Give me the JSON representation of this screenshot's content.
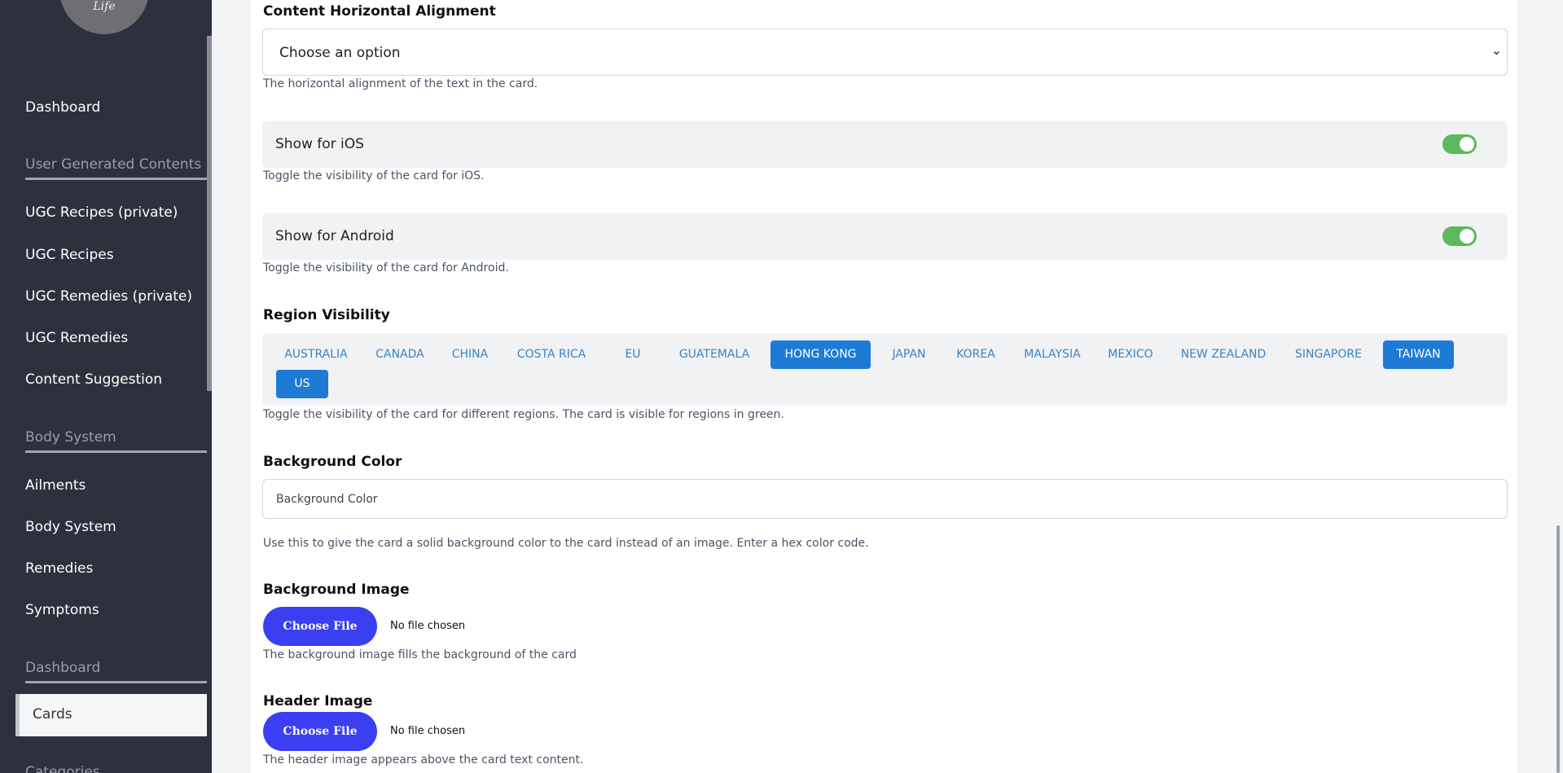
{
  "sidebar": {
    "logo_text": "Life",
    "items": [
      {
        "label": "Dashboard"
      },
      {
        "label": "User Generated Contents",
        "heading": true
      },
      {
        "label": "UGC Recipes (private)"
      },
      {
        "label": "UGC Recipes"
      },
      {
        "label": "UGC Remedies (private)"
      },
      {
        "label": "UGC Remedies"
      },
      {
        "label": "Content Suggestion"
      },
      {
        "label": "Body System",
        "heading": true
      },
      {
        "label": "Ailments"
      },
      {
        "label": "Body System"
      },
      {
        "label": "Remedies"
      },
      {
        "label": "Symptoms"
      },
      {
        "label": "Dashboard",
        "heading": true
      },
      {
        "label": "Cards",
        "active": true
      },
      {
        "label": "Categories",
        "heading": true
      }
    ]
  },
  "form": {
    "alignment": {
      "label": "Content Horizontal Alignment",
      "value": "Choose an option",
      "help": "The horizontal alignment of the text in the card."
    },
    "ios": {
      "label": "Show for iOS",
      "enabled": true,
      "help": "Toggle the visibility of the card for iOS."
    },
    "android": {
      "label": "Show for Android",
      "enabled": true,
      "help": "Toggle the visibility of the card for Android."
    },
    "regions": {
      "label": "Region Visibility",
      "help": "Toggle the visibility of the card for different regions. The card is visible for regions in green.",
      "items": [
        {
          "name": "AUSTRALIA",
          "selected": false
        },
        {
          "name": "CANADA",
          "selected": false
        },
        {
          "name": "CHINA",
          "selected": false
        },
        {
          "name": "COSTA RICA",
          "selected": false
        },
        {
          "name": "EU",
          "selected": false
        },
        {
          "name": "GUATEMALA",
          "selected": false
        },
        {
          "name": "HONG KONG",
          "selected": true
        },
        {
          "name": "JAPAN",
          "selected": false
        },
        {
          "name": "KOREA",
          "selected": false
        },
        {
          "name": "MALAYSIA",
          "selected": false
        },
        {
          "name": "MEXICO",
          "selected": false
        },
        {
          "name": "NEW ZEALAND",
          "selected": false
        },
        {
          "name": "SINGAPORE",
          "selected": false
        },
        {
          "name": "TAIWAN",
          "selected": true
        },
        {
          "name": "US",
          "selected": true
        }
      ]
    },
    "background_color": {
      "label": "Background Color",
      "placeholder": "Background Color",
      "help": "Use this to give the card a solid background color to the card instead of an image. Enter a hex color code."
    },
    "background_image": {
      "label": "Background Image",
      "button": "Choose File",
      "status": "No file chosen",
      "help": "The background image fills the background of the card"
    },
    "header_image": {
      "label": "Header Image",
      "button": "Choose File",
      "status": "No file chosen",
      "help": "The header image appears above the card text content."
    }
  },
  "colors": {
    "sidebar_bg": "#2e303e",
    "toggle_on": "#5cb85c",
    "region_selected": "#1d7bd6",
    "file_button": "#3b3ff2"
  }
}
